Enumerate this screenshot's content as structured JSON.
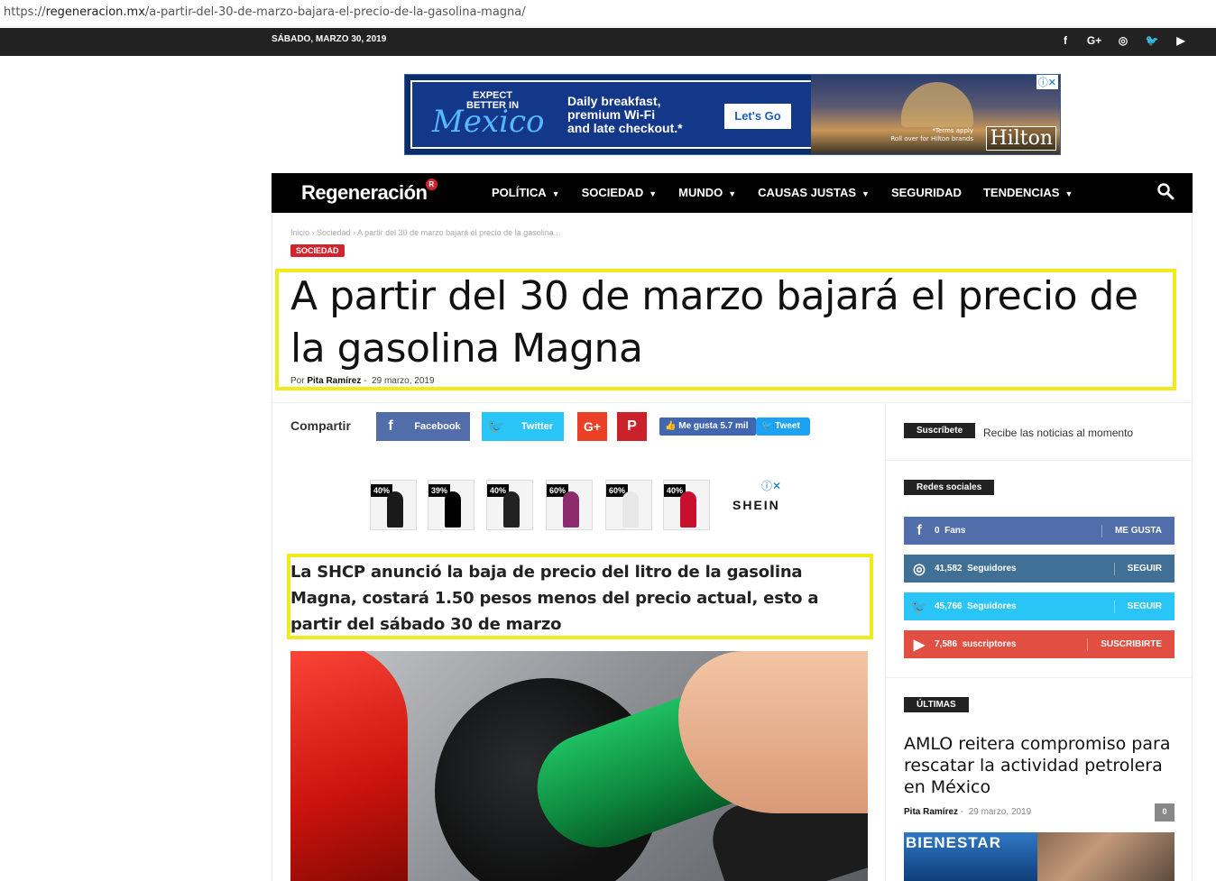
{
  "browser": {
    "url_scheme": "https://",
    "url_host": "regeneracion.mx",
    "url_path": "/a-partir-del-30-de-marzo-bajara-el-precio-de-la-gasolina-magna/"
  },
  "topbar": {
    "date": "SÁBADO, MARZO 30, 2019",
    "social_icons": [
      "facebook-icon",
      "google-plus-icon",
      "instagram-icon",
      "twitter-icon",
      "youtube-icon"
    ],
    "social_glyphs": [
      "f",
      "G+",
      "◎",
      "🐦",
      "▶"
    ]
  },
  "ad_top": {
    "line1": "EXPECT",
    "line2": "BETTER IN",
    "brand_word": "Mexico",
    "text1": "Daily breakfast,",
    "text2": "premium Wi-Fi",
    "text3": "and late checkout.*",
    "cta": "Let's Go",
    "terms1": "*Terms apply",
    "terms2": "Roll over for Hilton brands",
    "hilton": "Hilton"
  },
  "nav": {
    "logo": "Regeneración",
    "logo_badge": "R",
    "items": [
      {
        "label": "POLÍTICA",
        "dropdown": true
      },
      {
        "label": "SOCIEDAD",
        "dropdown": true
      },
      {
        "label": "MUNDO",
        "dropdown": true
      },
      {
        "label": "CAUSAS JUSTAS",
        "dropdown": true
      },
      {
        "label": "SEGURIDAD",
        "dropdown": false
      },
      {
        "label": "TENDENCIAS",
        "dropdown": true
      }
    ]
  },
  "article": {
    "breadcrumb": [
      "Inicio",
      "Sociedad",
      "A partir del 30 de marzo bajará el precio de la gasolina..."
    ],
    "category": "SOCIEDAD",
    "title": "A partir del 30 de marzo bajará el precio de la gasolina Magna",
    "by": "Por",
    "author": "Pita Ramírez",
    "date": "29 marzo, 2019",
    "lead": "La SHCP anunció la baja de precio del litro de la gasolina Magna, costará 1.50 pesos menos del precio actual, esto a partir del sábado 30 de marzo"
  },
  "share": {
    "label": "Compartir",
    "facebook": "Facebook",
    "twitter": "Twitter",
    "gplus": "G+",
    "pinterest": "P",
    "me_gusta": "Me gusta 5.7 mil",
    "tweet": "Tweet"
  },
  "ad_mid": {
    "badges": [
      "40%",
      "39%",
      "40%",
      "60%",
      "60%",
      "40%"
    ],
    "brand": "SHEIN"
  },
  "sidebar": {
    "subscribe_label": "Suscríbete",
    "subscribe_text": "Recibe las noticias al momento",
    "social_label": "Redes sociales",
    "rows": [
      {
        "count": "0",
        "unit": "Fans",
        "action": "ME GUSTA"
      },
      {
        "count": "41,582",
        "unit": "Seguidores",
        "action": "SEGUIR"
      },
      {
        "count": "45,766",
        "unit": "Seguidores",
        "action": "SEGUIR"
      },
      {
        "count": "7,586",
        "unit": "suscriptores",
        "action": "SUSCRIBIRTE"
      }
    ],
    "latest_label": "ÚLTIMAS",
    "latest_title": "AMLO reitera compromiso para rescatar la actividad petrolera en México",
    "latest_author": "Pita Ramírez",
    "latest_date": "29 marzo, 2019",
    "latest_comments": "0",
    "latest_img_text": "BIENESTAR"
  }
}
